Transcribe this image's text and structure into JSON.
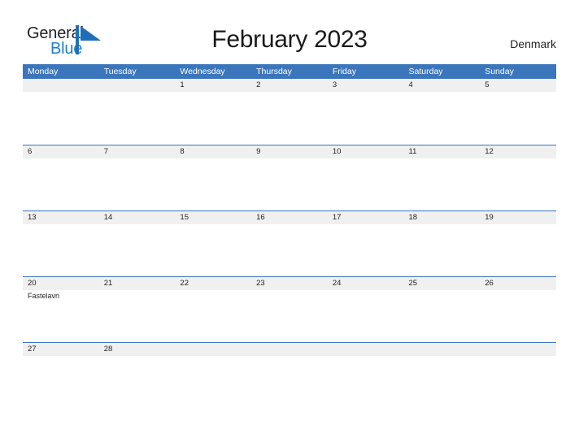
{
  "brand": {
    "name_part1": "General",
    "name_part2": "Blue",
    "mark_icon": "blue-flag-triangle-icon",
    "colors": {
      "text_dark": "#231f20",
      "blue": "#1f7fd0"
    }
  },
  "header": {
    "title": "February 2023",
    "country": "Denmark"
  },
  "calendar": {
    "colors": {
      "header_blue": "#3b76bc",
      "band_gray": "#f0f0f0",
      "row_rule_blue": "#3b76bc",
      "text": "#231f20",
      "header_text": "#ffffff"
    },
    "weekdays": [
      "Monday",
      "Tuesday",
      "Wednesday",
      "Thursday",
      "Friday",
      "Saturday",
      "Sunday"
    ],
    "weeks": [
      {
        "bordered": false,
        "days": [
          {
            "number": "",
            "events": []
          },
          {
            "number": "",
            "events": []
          },
          {
            "number": "1",
            "events": []
          },
          {
            "number": "2",
            "events": []
          },
          {
            "number": "3",
            "events": []
          },
          {
            "number": "4",
            "events": []
          },
          {
            "number": "5",
            "events": []
          }
        ]
      },
      {
        "bordered": true,
        "days": [
          {
            "number": "6",
            "events": []
          },
          {
            "number": "7",
            "events": []
          },
          {
            "number": "8",
            "events": []
          },
          {
            "number": "9",
            "events": []
          },
          {
            "number": "10",
            "events": []
          },
          {
            "number": "11",
            "events": []
          },
          {
            "number": "12",
            "events": []
          }
        ]
      },
      {
        "bordered": true,
        "days": [
          {
            "number": "13",
            "events": []
          },
          {
            "number": "14",
            "events": []
          },
          {
            "number": "15",
            "events": []
          },
          {
            "number": "16",
            "events": []
          },
          {
            "number": "17",
            "events": []
          },
          {
            "number": "18",
            "events": []
          },
          {
            "number": "19",
            "events": []
          }
        ]
      },
      {
        "bordered": true,
        "days": [
          {
            "number": "20",
            "events": [
              "Fastelavn"
            ]
          },
          {
            "number": "21",
            "events": []
          },
          {
            "number": "22",
            "events": []
          },
          {
            "number": "23",
            "events": []
          },
          {
            "number": "24",
            "events": []
          },
          {
            "number": "25",
            "events": []
          },
          {
            "number": "26",
            "events": []
          }
        ]
      },
      {
        "bordered": true,
        "days": [
          {
            "number": "27",
            "events": []
          },
          {
            "number": "28",
            "events": []
          },
          {
            "number": "",
            "events": []
          },
          {
            "number": "",
            "events": []
          },
          {
            "number": "",
            "events": []
          },
          {
            "number": "",
            "events": []
          },
          {
            "number": "",
            "events": []
          }
        ]
      }
    ]
  }
}
